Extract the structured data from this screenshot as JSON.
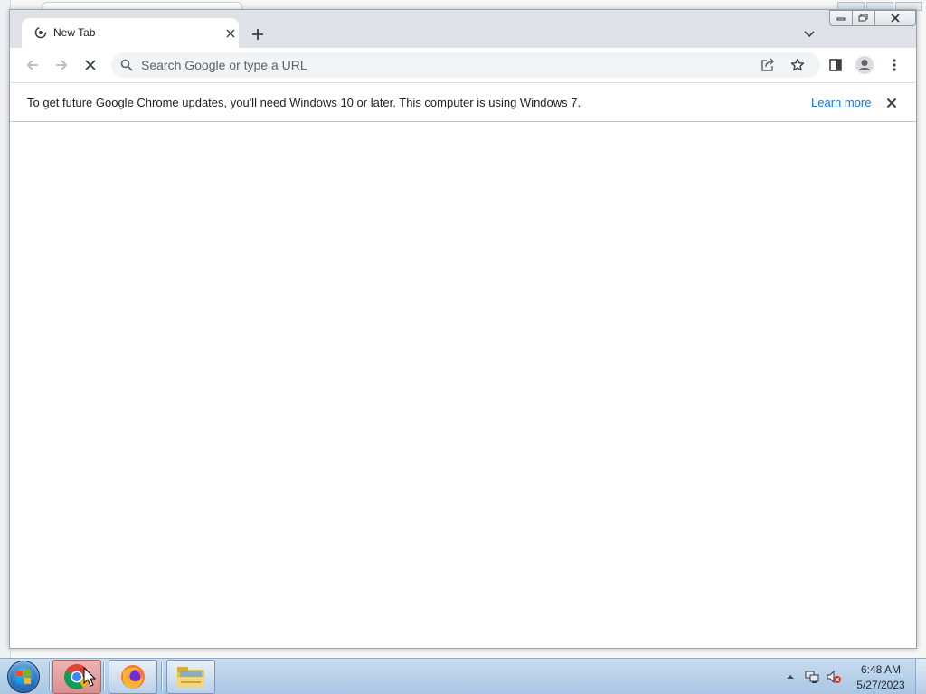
{
  "browser": {
    "tab": {
      "title": "New Tab",
      "favicon": "chrome-loading-icon"
    },
    "toolbar": {
      "omnibox_placeholder": "Search Google or type a URL",
      "omnibox_value": ""
    },
    "infobar": {
      "message": "To get future Google Chrome updates, you'll need Windows 10 or later. This computer is using Windows 7.",
      "link_label": "Learn more"
    }
  },
  "taskbar": {
    "apps": [
      {
        "name": "Google Chrome",
        "icon": "chrome-icon",
        "active": true
      },
      {
        "name": "Firefox",
        "icon": "firefox-icon",
        "active": false
      },
      {
        "name": "Windows Explorer",
        "icon": "folder-icon",
        "active": false
      }
    ],
    "clock": {
      "time": "6:48 AM",
      "date": "5/27/2023"
    }
  },
  "colors": {
    "tab_strip": "#dee1e6",
    "link": "#1a73e8",
    "taskbar": "#b9d1ea",
    "active_task": "#e0a0a0"
  }
}
